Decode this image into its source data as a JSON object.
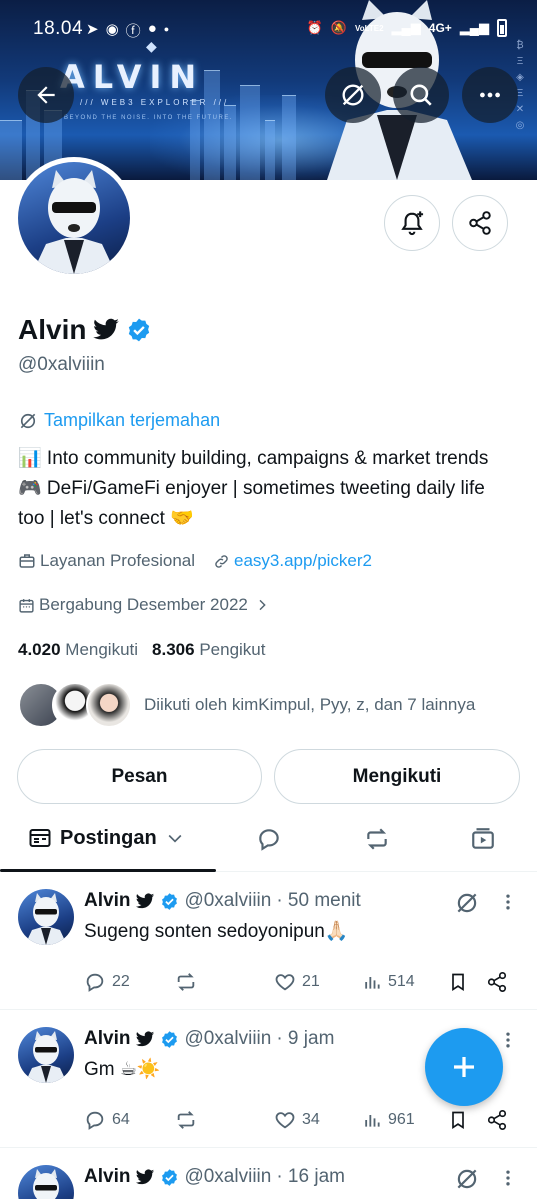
{
  "status_bar": {
    "time": "18.04",
    "network": "4G+",
    "volte": "VoLTE2"
  },
  "banner": {
    "brand_name": "ALVIN",
    "brand_subtitle": "/// WEB3 EXPLORER ///",
    "brand_tagline": "BEYOND THE NOISE. INTO THE FUTURE."
  },
  "profile": {
    "name": "Alvin",
    "handle": "@0xalviiin",
    "translate_label": "Tampilkan terjemahan",
    "bio_line1": "📊 Into community building, campaigns & market trends",
    "bio_line2": "🎮 DeFi/GameFi enjoyer | sometimes tweeting daily life",
    "bio_line3": "too | let's connect 🤝",
    "professional_label": "Layanan Profesional",
    "link": "easy3.app/picker2",
    "joined": "Bergabung Desember 2022",
    "following_count": "4.020",
    "following_label": "Mengikuti",
    "followers_count": "8.306",
    "followers_label": "Pengikut",
    "followed_by": "Diikuti oleh kimKimpul, Pyy, z, dan 7 lainnya"
  },
  "buttons": {
    "message": "Pesan",
    "following": "Mengikuti"
  },
  "tabs": {
    "posts": "Postingan"
  },
  "tweets": [
    {
      "name": "Alvin",
      "handle": "@0xalviiin",
      "time": "· 50 menit",
      "text": "Sugeng sonten sedoyonipun🙏🏻",
      "replies": "22",
      "likes": "21",
      "views": "514"
    },
    {
      "name": "Alvin",
      "handle": "@0xalviiin",
      "time": "· 9 jam",
      "text": "Gm ☕☀️",
      "replies": "64",
      "likes": "34",
      "views": "961"
    },
    {
      "name": "Alvin",
      "handle": "@0xalviiin",
      "time": "· 16 jam"
    }
  ],
  "colors": {
    "accent": "#1d9bf0",
    "text_primary": "#0f1419",
    "text_secondary": "#536471",
    "border": "#cfd9de"
  }
}
